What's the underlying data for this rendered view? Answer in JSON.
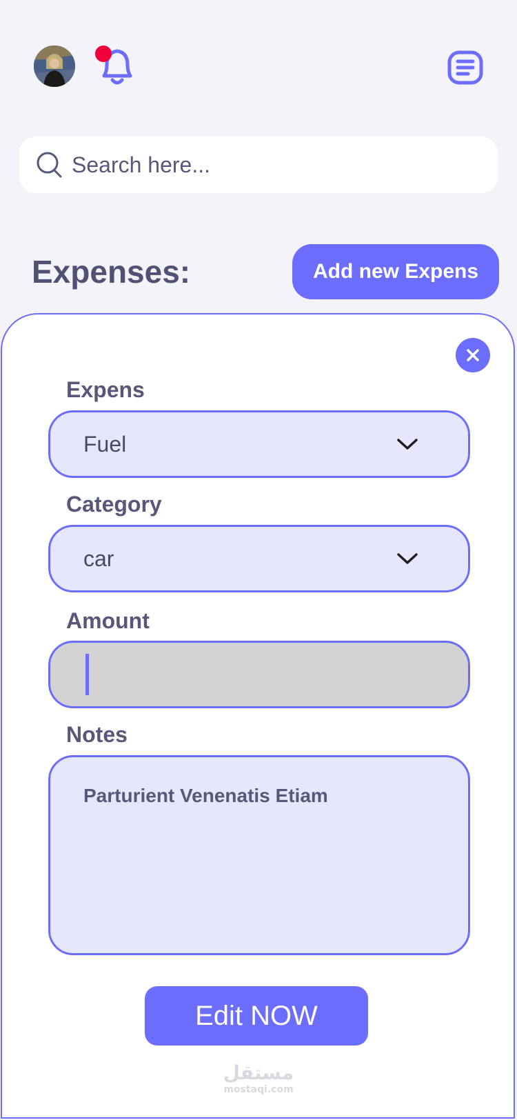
{
  "header": {
    "avatar_icon": "user-avatar",
    "notification_icon": "bell-icon",
    "notification_badge_color": "#f0003a",
    "menu_icon": "menu-icon"
  },
  "search": {
    "placeholder": "Search here...",
    "value": "",
    "icon": "search-icon"
  },
  "page": {
    "title": "Expenses:",
    "add_button_label": "Add new Expens"
  },
  "form": {
    "close_icon": "close-icon",
    "expense": {
      "label": "Expens",
      "value": "Fuel"
    },
    "category": {
      "label": "Category",
      "value": "car"
    },
    "amount": {
      "label": "Amount",
      "value": ""
    },
    "notes": {
      "label": "Notes",
      "value": "Parturient Venenatis Etiam"
    },
    "submit_label": "Edit NOW"
  },
  "watermark": {
    "arabic": "مستقل",
    "latin": "mostaqi.com"
  },
  "colors": {
    "accent": "#6c6dfc",
    "background": "#f4f3f9",
    "field_fill": "#e6e6fd",
    "text": "#57577a"
  }
}
